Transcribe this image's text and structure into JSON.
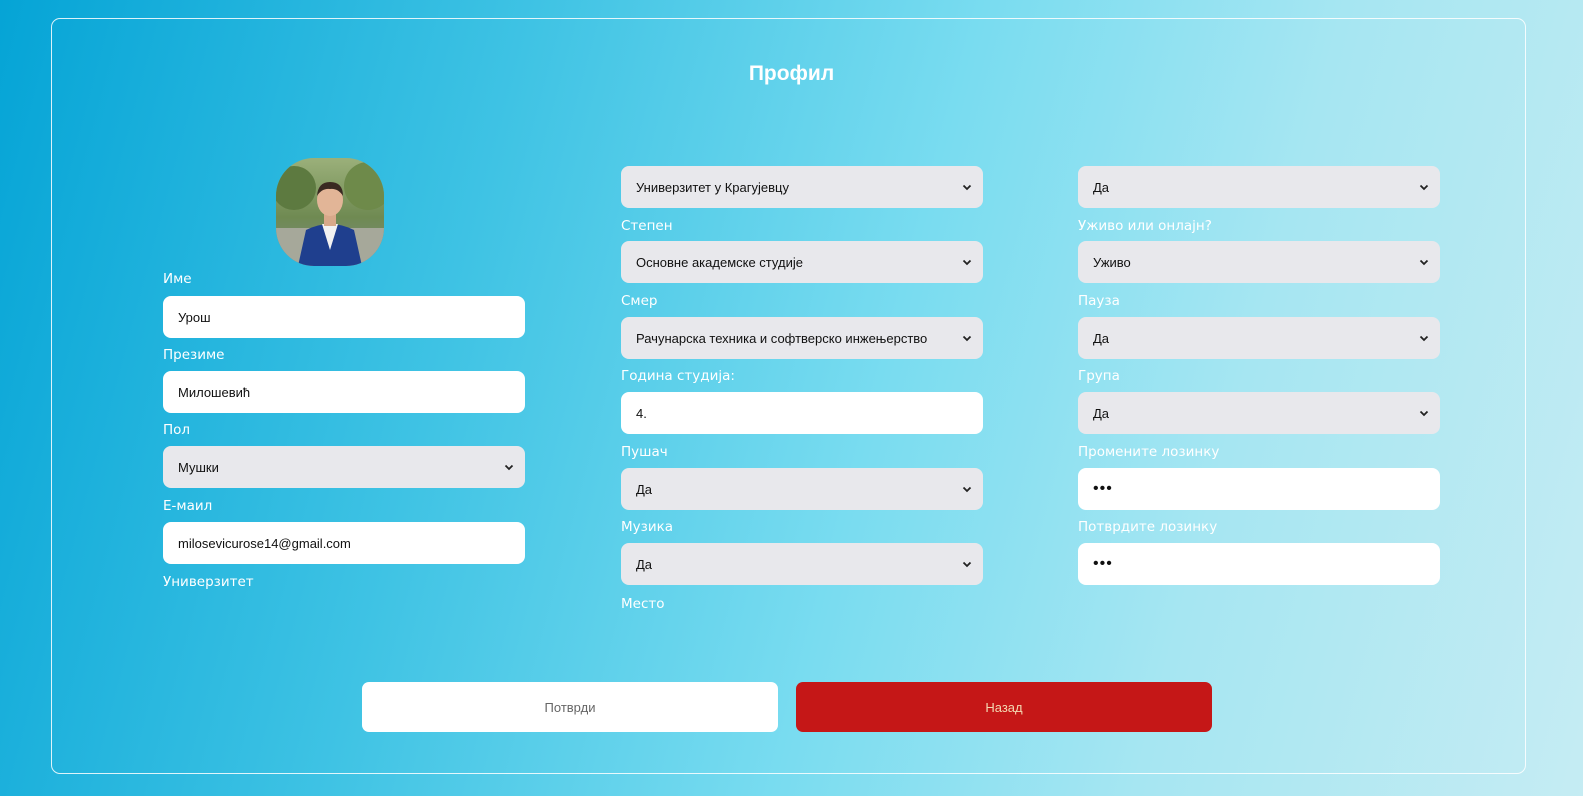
{
  "page": {
    "title": "Профил"
  },
  "left": {
    "first_name_label": "Име",
    "first_name_value": "Урош",
    "last_name_label": "Презиме",
    "last_name_value": "Милошевић",
    "gender_label": "Пол",
    "gender_value": "Мушки",
    "email_label": "Е-маил",
    "email_value": "milosevicurose14@gmail.com",
    "university_label": "Универзитет"
  },
  "middle": {
    "university_value": "Универзитет у Крагујевцу",
    "degree_label": "Степен",
    "degree_value": "Основне академске студије",
    "major_label": "Смер",
    "major_value": "Рачунарска техника и софтверско инжењерство",
    "year_label": "Година студија:",
    "year_value": "4.",
    "smoker_label": "Пушач",
    "smoker_value": "Да",
    "music_label": "Музика",
    "music_value": "Да",
    "place_label": "Место"
  },
  "right": {
    "place_value": "Да",
    "live_online_label": "Уживо или онлајн?",
    "live_online_value": "Уживо",
    "pause_label": "Пауза",
    "pause_value": "Да",
    "group_label": "Група",
    "group_value": "Да",
    "change_password_label": "Промените лозинку",
    "change_password_value": "•••",
    "confirm_password_label": "Потврдите лозинку",
    "confirm_password_value": "•••"
  },
  "buttons": {
    "confirm_label": "Потврди",
    "back_label": "Назад"
  },
  "colors": {
    "back_button": "#c51717",
    "field_select": "#e8e8ec",
    "field_input": "#ffffff"
  }
}
